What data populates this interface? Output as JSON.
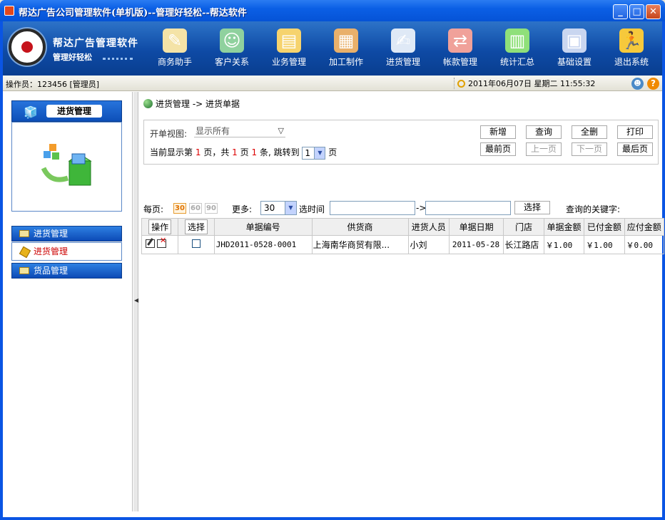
{
  "window": {
    "title": "帮达广告公司管理软件(单机版)--管理好轻松--帮达软件"
  },
  "brand": {
    "name": "帮达广告管理软件",
    "slogan": "管理好轻松"
  },
  "nav": [
    {
      "label": "商务助手",
      "icon": "pen-paper-icon"
    },
    {
      "label": "客户关系",
      "icon": "people-icon"
    },
    {
      "label": "业务管理",
      "icon": "clipboard-icon"
    },
    {
      "label": "加工制作",
      "icon": "palette-icon"
    },
    {
      "label": "进货管理",
      "icon": "notepad-pen-icon"
    },
    {
      "label": "帐款管理",
      "icon": "exchange-arrows-icon"
    },
    {
      "label": "统计汇总",
      "icon": "chart-icon"
    },
    {
      "label": "基础设置",
      "icon": "building-icon"
    },
    {
      "label": "退出系统",
      "icon": "running-man-icon"
    }
  ],
  "toolbar": {
    "operator": "操作员：123456 [管理员]",
    "datetime": "2011年06月07日 星期二  11:55:32"
  },
  "sidebar": {
    "header": "进货管理",
    "buttons": [
      "进货管理",
      "货品管理"
    ],
    "active_sub": "进货管理"
  },
  "breadcrumb": "进货管理 -> 进货单据",
  "filter": {
    "view_label": "开单视图:",
    "view_value": "显示所有",
    "info_prefix": "当前显示第",
    "current_page": "1",
    "info_mid1": "页，共",
    "total_pages": "1",
    "info_mid2": "页",
    "total_records": "1",
    "info_mid3": "条,  跳转到",
    "jump_value": "1",
    "info_suffix": "页",
    "buttons": {
      "new": "新增",
      "query": "查询",
      "delete_all": "全删",
      "print": "打印",
      "first": "最前页",
      "prev": "上一页",
      "next": "下一页",
      "last": "最后页"
    }
  },
  "controls": {
    "per_page_label": "每页:",
    "per_page_options": [
      "30",
      "60",
      "90"
    ],
    "more_label": "更多:",
    "more_value": "30",
    "time_label": "选时间",
    "time_arrow": "->",
    "select_button": "选择",
    "keyword_label": "查询的关键字:"
  },
  "table": {
    "headers": [
      "操作",
      "选择",
      "单据编号",
      "供货商",
      "进货人员",
      "单据日期",
      "门店",
      "单据金额",
      "已付金额",
      "应付金额"
    ],
    "rows": [
      {
        "id": "JHD2011-0528-0001",
        "supplier": "上海南华商贸有限...",
        "person": "小刘",
        "date": "2011-05-28",
        "store": "长江路店",
        "amount": "￥1.00",
        "paid": "￥1.00",
        "due": "￥0.00"
      }
    ]
  }
}
